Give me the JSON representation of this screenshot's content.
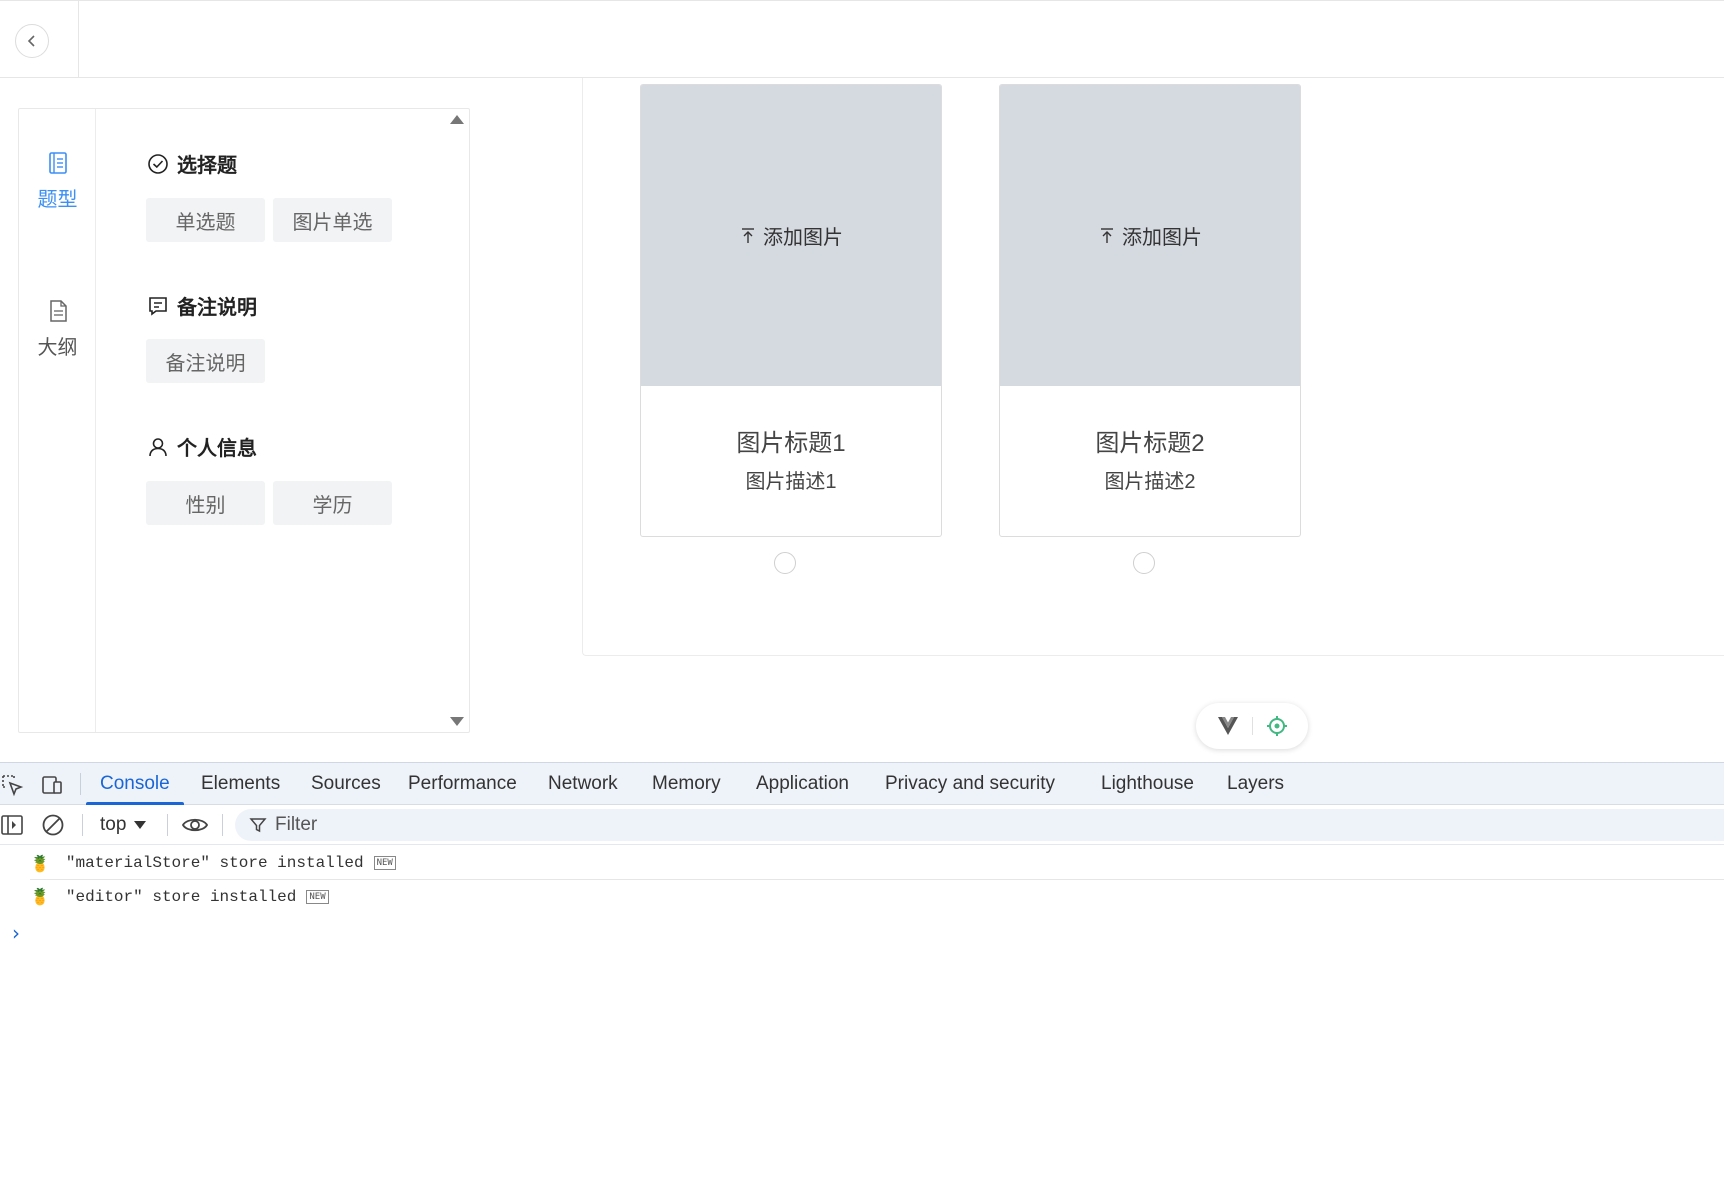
{
  "topbar": {
    "back_icon": "chevron-left-icon"
  },
  "sidebar": {
    "rail": [
      {
        "label": "题型",
        "icon": "question-list-icon",
        "active": true
      },
      {
        "label": "大纲",
        "icon": "document-icon",
        "active": false
      }
    ],
    "groups": [
      {
        "title": "选择题",
        "icon": "check-circle-icon",
        "items": [
          "单选题",
          "图片单选"
        ]
      },
      {
        "title": "备注说明",
        "icon": "comment-icon",
        "items": [
          "备注说明"
        ]
      },
      {
        "title": "个人信息",
        "icon": "user-icon",
        "items": [
          "性别",
          "学历"
        ]
      }
    ]
  },
  "canvas": {
    "cards": [
      {
        "upload_label": "添加图片",
        "title": "图片标题1",
        "description": "图片描述1",
        "selected": false
      },
      {
        "upload_label": "添加图片",
        "title": "图片标题2",
        "description": "图片描述2",
        "selected": false
      }
    ]
  },
  "floating_tools": {
    "icons": [
      "vue-devtools-icon",
      "target-icon"
    ],
    "accent": "#42b883"
  },
  "devtools": {
    "tabs": [
      "Console",
      "Elements",
      "Sources",
      "Performance",
      "Network",
      "Memory",
      "Application",
      "Privacy and security",
      "Lighthouse",
      "Layers"
    ],
    "active_tab": "Console",
    "context": "top",
    "filter_placeholder": "Filter",
    "logs": [
      {
        "text": "\"materialStore\" store installed",
        "badge": "NEW"
      },
      {
        "text": "\"editor\" store installed",
        "badge": "NEW"
      }
    ],
    "prompt": "›"
  },
  "colors": {
    "accent": "#3b8ff5",
    "devtools_accent": "#1a66d6",
    "image_placeholder": "#d5d9e0"
  }
}
